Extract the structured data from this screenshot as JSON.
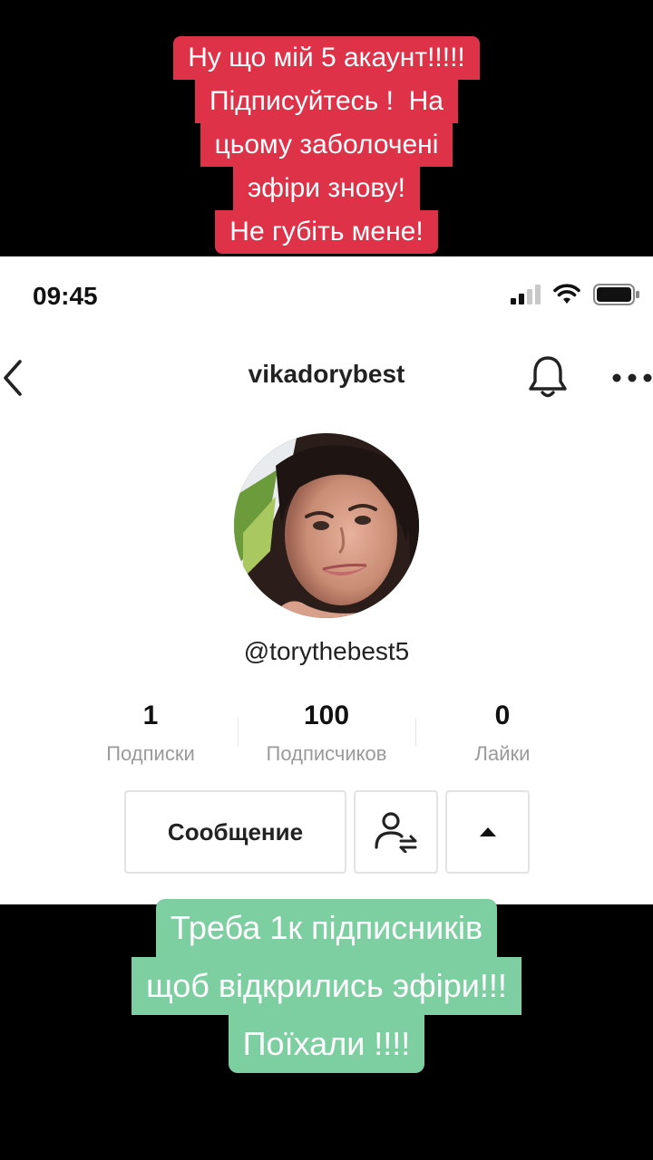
{
  "overlay_top": {
    "lines": [
      "Ну що мій 5 акаунт!!!!!",
      "Підписуйтесь !  На",
      "цьому заболочені",
      "эфіри знову!",
      "Не губіть мене!"
    ],
    "bg_color": "#dd3247"
  },
  "status_bar": {
    "time": "09:45",
    "icons": [
      "cellular-signal-icon",
      "wifi-icon",
      "battery-icon"
    ]
  },
  "nav": {
    "title": "vikadorybest",
    "back_icon": "chevron-left-icon",
    "bell_icon": "bell-icon",
    "more_icon": "more-dots-icon"
  },
  "profile": {
    "handle": "@torythebest5",
    "stats": [
      {
        "value": "1",
        "label": "Подписки"
      },
      {
        "value": "100",
        "label": "Подписчиков"
      },
      {
        "value": "0",
        "label": "Лайки"
      }
    ],
    "buttons": {
      "message_label": "Сообщение",
      "follow_icon": "user-swap-icon",
      "expand_icon": "caret-up-icon"
    }
  },
  "overlay_bottom": {
    "lines": [
      "Треба 1к підписників",
      "щоб відкрились эфіри!!!",
      "Поїхали !!!!"
    ],
    "bg_color": "#7dcea0"
  }
}
